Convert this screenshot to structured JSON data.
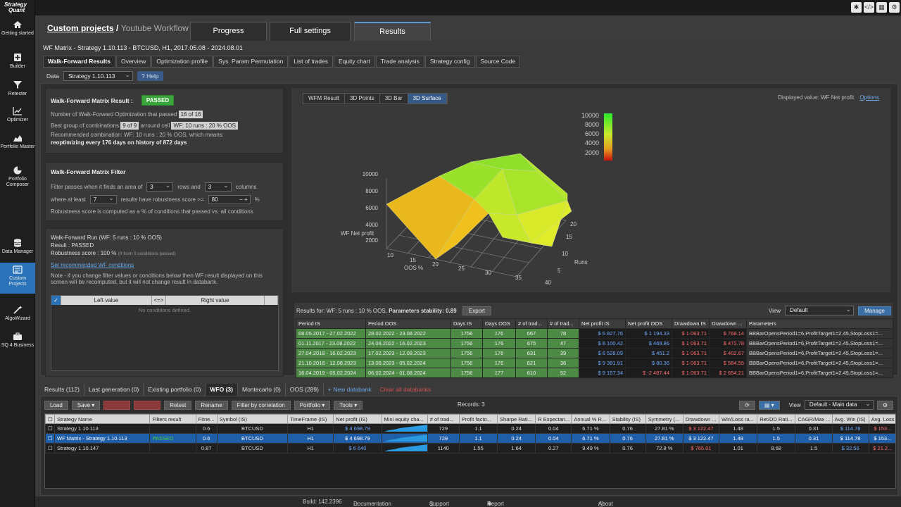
{
  "app": {
    "logo_line1": "Strategy",
    "logo_line2": "Quant",
    "breadcrumb_link": "Custom projects",
    "breadcrumb_sep": "/",
    "breadcrumb_current": "Youtube Workflow",
    "main_tabs": [
      "Progress",
      "Full settings",
      "Results"
    ]
  },
  "sidebar": [
    {
      "label": "Getting started",
      "icon": "home-icon"
    },
    {
      "label": "Builder",
      "icon": "plus-box-icon"
    },
    {
      "label": "Retester",
      "icon": "funnel-icon"
    },
    {
      "label": "Optimizer",
      "icon": "line-chart-icon"
    },
    {
      "label": "Portfolio Master",
      "icon": "area-chart-icon"
    },
    {
      "label": "Portfolio Composer",
      "icon": "pie-chart-icon"
    },
    {
      "label": "Data Manager",
      "icon": "database-icon"
    },
    {
      "label": "Custom Projects",
      "icon": "projects-icon"
    },
    {
      "label": "AlgoWizard",
      "icon": "wand-icon"
    },
    {
      "label": "SQ 4 Business",
      "icon": "briefcase-icon"
    }
  ],
  "subtitle": "WF Matrix - Strategy 1.10.113 - BTCUSD, H1, 2017.05.08 - 2024.08.01",
  "sub_tabs": [
    "Walk-Forward Results",
    "Overview",
    "Optimization profile",
    "Sys. Param Permutation",
    "List of trades",
    "Equity chart",
    "Trade analysis",
    "Strategy config",
    "Source Code"
  ],
  "data_row": {
    "label": "Data",
    "value": "Strategy 1.10.113",
    "help": "Help"
  },
  "matrix_result": {
    "title": "Walk-Forward Matrix Result :",
    "status": "PASSED",
    "line1": "Number of Walk-Forward Optimization that passed",
    "line1_value": "16 of 16",
    "line2": "Best group of combinations",
    "line2_value": "9 of 9",
    "line2b": "arround cell",
    "line2b_value": "WF: 10 runs : 20 % OOS",
    "line3": "Recommended combination: WF: 10 runs : 20 % OOS, which means:",
    "line4": "reoptimizing every 176 days on history of 872 days"
  },
  "matrix_filter": {
    "title": "Walk-Forward Matrix Filter",
    "row1a": "Filter passes when it finds an area of",
    "rows_value": "3",
    "row1b": "rows and",
    "cols_value": "3",
    "row1c": "columns",
    "row2a": "where at least",
    "atleast_value": "7",
    "row2b": "results have robustness score >=",
    "score_value": "80",
    "row2c": "%",
    "note": "Robustness score is computed as a % of conditions that passed vs. all conditions"
  },
  "wf_run": {
    "line1": "Walk-Forward Run (WF: 5 runs : 10 % OOS)",
    "line2": "Result : PASSED",
    "line3": "Robustness score : 100 %",
    "line3_small": "(0 from 0 conditions passed)",
    "link": "Set recommended WF conditions",
    "note1": "Note - if you change filter values or conditions below then WF result displayed on this",
    "note2": "screen will be recomputed, but it will not change result in databank.",
    "col_left": "Left value",
    "col_op": "<=>",
    "col_right": "Right value",
    "empty": "No conditions defined."
  },
  "chart_tabs": [
    "WFM Result",
    "3D Points",
    "3D Bar",
    "3D Surface"
  ],
  "displayed_value": "Displayed value: WF Net profit",
  "options_link": "Options",
  "chart_data": {
    "type": "surface",
    "zlabel": "WF Net profit",
    "xlabel": "OOS %",
    "ylabel": "Runs",
    "x_ticks": [
      "10",
      "15",
      "20",
      "25",
      "30",
      "35",
      "40"
    ],
    "y_ticks": [
      "5",
      "10",
      "15",
      "20"
    ],
    "z_ticks": [
      "2000",
      "4000",
      "6000",
      "8000",
      "10000"
    ],
    "legend_ticks": [
      "10000",
      "8000",
      "6000",
      "4000",
      "2000"
    ]
  },
  "results": {
    "header_prefix": "Results for: WF: 5 runs : 10 % OOS,",
    "header_bold": "Parameters stability: 0.89",
    "export": "Export",
    "view_label": "View",
    "view_value": "Default",
    "manage": "Manage",
    "columns": [
      "Period IS",
      "Period OOS",
      "Days IS",
      "Days OOS",
      "# of trad...",
      "# of trad...",
      "Net profit IS",
      "Net profit OOS",
      "Drawdown IS",
      "Drawdown ...",
      "Parameters"
    ],
    "rows": [
      [
        "08.05.2017 - 27.02.2022",
        "28.02.2022 - 23.08.2022",
        "1756",
        "176",
        "667",
        "78",
        "$ 6 827.76",
        "$ 1 194.33",
        "$ 1 063.71",
        "$ 768.14",
        "BBBarOpensPeriod1=6,ProfitTarget1=2.45,StopLoss1=..."
      ],
      [
        "01.11.2017 - 23.08.2022",
        "24.08.2022 - 16.02.2023",
        "1756",
        "176",
        "675",
        "47",
        "$ 8 100.42",
        "$ 469.86",
        "$ 1 063.71",
        "$ 472.78",
        "BBBarOpensPeriod1=6,ProfitTarget1=2.45,StopLoss1=..."
      ],
      [
        "27.04.2018 - 16.02.2023",
        "17.02.2023 - 12.08.2023",
        "1756",
        "176",
        "631",
        "39",
        "$ 8 528.09",
        "$ 451.2",
        "$ 1 063.71",
        "$ 402.67",
        "BBBarOpensPeriod1=6,ProfitTarget1=2.45,StopLoss1=..."
      ],
      [
        "21.10.2018 - 12.08.2023",
        "13.08.2023 - 05.02.2024",
        "1756",
        "176",
        "621",
        "36",
        "$ 9 391.91",
        "$ 80.36",
        "$ 1 063.71",
        "$ 584.55",
        "BBBarOpensPeriod1=6,ProfitTarget1=2.45,StopLoss1=..."
      ],
      [
        "16.04.2019 - 05.02.2024",
        "06.02.2024 - 01.08.2024",
        "1756",
        "177",
        "610",
        "52",
        "$ 9 157.34",
        "$ -2 487.44",
        "$ 1 063.71",
        "$ 2 654.21",
        "BBBarOpensPeriod1=6,ProfitTarget1=2.45,StopLoss1=..."
      ]
    ]
  },
  "bottom_tabs": [
    "Results (112)",
    "Last generation (0)",
    "Existing portfolio (0)",
    "WFO (3)",
    "Montecarlo (0)",
    "OOS (289)",
    "+ New databank",
    "Clear all databanks"
  ],
  "toolbar": {
    "load": "Load",
    "save": "Save",
    "retest": "Retest",
    "rename": "Rename",
    "filter": "Filter by correlation",
    "portfolio": "Portfolio",
    "tools": "Tools",
    "records": "Records: 3",
    "view_label": "View",
    "view_value": "Default - Main data"
  },
  "databank": {
    "columns": [
      "Strategy Name",
      "Filters result",
      "Fitne...",
      "Symbol (IS)",
      "TimeFrame (IS)",
      "Net profit (IS)",
      "Mini equity cha...",
      "# of trad...",
      "Profit facto...",
      "Sharpe Rati...",
      "R Expectan...",
      "Annual % R...",
      "Stability (IS)",
      "Symmetry (...",
      "Drawdown ...",
      "Win/Loss ra...",
      "Ret/DD Rati...",
      "CAGR/Max ...",
      "Avg. Win (IS)",
      "Avg. Loss"
    ],
    "rows": [
      [
        "Strategy 1.10.113",
        "",
        "0.6",
        "BTCUSD",
        "H1",
        "$ 4 698.79",
        "",
        "729",
        "1.1",
        "0.24",
        "0.04",
        "6.71 %",
        "0.76",
        "27.81 %",
        "$ 3 122.47",
        "1.48",
        "1.5",
        "0.31",
        "$ 114.78",
        "$ 153..."
      ],
      [
        "WF Matrix - Strategy 1.10.113",
        "PASSED",
        "0.6",
        "BTCUSD",
        "H1",
        "$ 4 698.79",
        "",
        "729",
        "1.1",
        "0.24",
        "0.04",
        "6.71 %",
        "0.76",
        "27.81 %",
        "$ 3 122.47",
        "1.48",
        "1.5",
        "0.31",
        "$ 114.78",
        "$ 153..."
      ],
      [
        "Strategy 1.10.147",
        "",
        "0.87",
        "BTCUSD",
        "H1",
        "$ 6 640",
        "",
        "1140",
        "1.55",
        "1.64",
        "0.27",
        "9.49 %",
        "0.76",
        "72.8 %",
        "$ 765.01",
        "1.01",
        "8.68",
        "1.5",
        "$ 32.56",
        "$ 21.2..."
      ]
    ]
  },
  "footer": {
    "build": "Build: 142.2396",
    "documentation": "Documentation",
    "support": "Support",
    "report": "Report Bug / Suggest Feature",
    "about": "About"
  }
}
